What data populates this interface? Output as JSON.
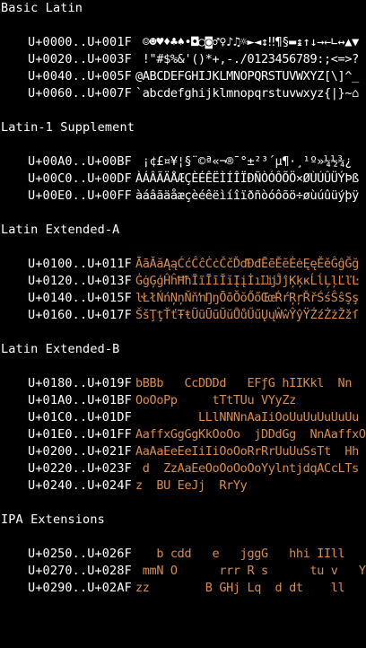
{
  "colors": {
    "background": "#000000",
    "text": "#ffffff",
    "unsupported_glyphs": "#d98c4a"
  },
  "sections": [
    {
      "title": "Basic Latin",
      "rows": [
        {
          "range": "U+0000..U+001F",
          "glyphs": " ☺☻♥♦♣♠•◘○◙♂♀♪♫☼►◄↕‼¶§▬↨↑↓→←∟↔▲▼"
        },
        {
          "range": "U+0020..U+003F",
          "glyphs": " !\"#$%&'()*+,-./0123456789:;<=>?"
        },
        {
          "range": "U+0040..U+005F",
          "glyphs": "@ABCDEFGHIJKLMNOPQRSTUVWXYZ[\\]^_"
        },
        {
          "range": "U+0060..U+007F",
          "glyphs": "`abcdefghijklmnopqrstuvwxyz{|}~⌂"
        }
      ]
    },
    {
      "title": "Latin-1 Supplement",
      "rows": [
        {
          "range": "U+00A0..U+00BF",
          "glyphs": " ¡¢£¤¥¦§¨©ª«¬­®¯°±²³´µ¶·¸¹º»¼½¾¿"
        },
        {
          "range": "U+00C0..U+00DF",
          "glyphs": "ÀÁÂÃÄÅÆÇÈÉÊËÌÍÎÏÐÑÒÓÔÕÖ×ØÙÚÛÜÝÞß"
        },
        {
          "range": "U+00E0..U+00FF",
          "glyphs": "àáâãäåæçèéêëìíîïðñòóôõö÷øùúûüýþÿ"
        }
      ]
    },
    {
      "title": "Latin Extended-A",
      "rows": [
        {
          "range": "U+0100..U+011F",
          "glyphs": "ĀāĂăĄąĆćĈĉĊċČčĎďĐđĒēĔĕĖėĘęĚěĜĝĞğ"
        },
        {
          "range": "U+0120..U+013F",
          "glyphs": "ĠġĢģĤĥĦħĨĩĪīĬĭĮįİıĲĳĴĵĶķĸĹĺĻļĽľĿ"
        },
        {
          "range": "U+0140..U+015F",
          "glyphs": "ŀŁłŃńŅņŇňŉŊŋŌōŎŏŐőŒœŔŕŖŗŘřŚśŜŝŞş"
        },
        {
          "range": "U+0160..U+017F",
          "glyphs": "ŠšŢţŤťŦŧŨũŪūŬŭŮůŰűŲųŴŵŶŷŸŹźŻżŽžſ"
        }
      ]
    },
    {
      "title": "Latin Extended-B",
      "rows": [
        {
          "range": "U+0180..U+019F",
          "glyphs": "bBBb   CcDDDd   EFƒG hIIKkl  Nn"
        },
        {
          "range": "U+01A0..U+01BF",
          "glyphs": "OoOoPp     tTtTUu VYyZz"
        },
        {
          "range": "U+01C0..U+01DF",
          "glyphs": "         LLlNNNnAaIiOoUuUuUuUuUu Aa"
        },
        {
          "range": "U+01E0..U+01FF",
          "glyphs": "AaffxGgGgKkOoOo  jDDdGg  NnAaffxOo"
        },
        {
          "range": "U+0200..U+021F",
          "glyphs": "AaAaEeEeIiIiOoOoRrRrUuUuSsTt  Hh"
        },
        {
          "range": "U+0220..U+023F",
          "glyphs": " d  ZzAaEeOoOoOoOoYylntjdqACcLTs"
        },
        {
          "range": "U+0240..U+024F",
          "glyphs": "z  BU EeJj  RrYy"
        }
      ]
    },
    {
      "title": "IPA Extensions",
      "rows": [
        {
          "range": "U+0250..U+026F",
          "glyphs": "   b cdd   e   jggG   hhi IIll"
        },
        {
          "range": "U+0270..U+028F",
          "glyphs": " mmN O      rrr R s      tu v   Y"
        },
        {
          "range": "U+0290..U+02AF",
          "glyphs": "zz        B GHj Lq  d dt    ll"
        }
      ]
    }
  ]
}
